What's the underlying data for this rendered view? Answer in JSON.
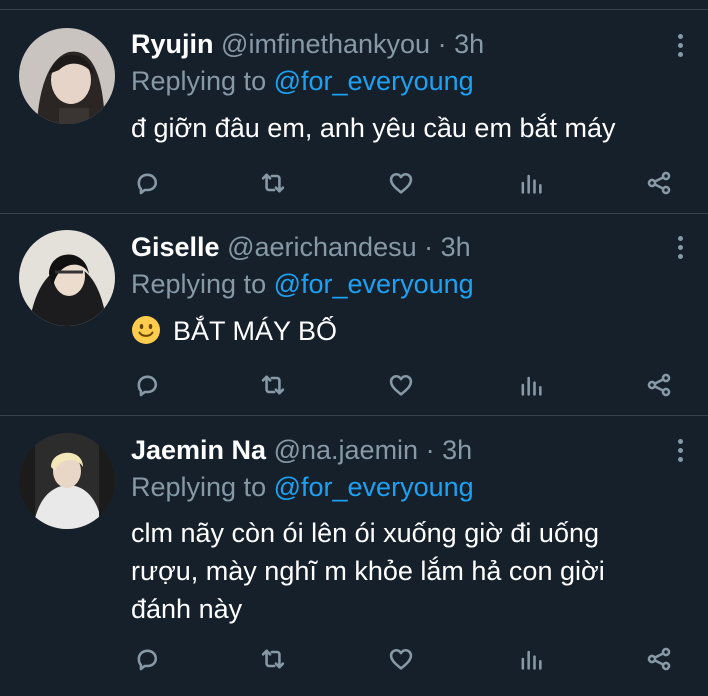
{
  "colors": {
    "background": "#15202b",
    "divider": "#38444d",
    "secondary_text": "#8899a6",
    "mention": "#1da1f2",
    "primary_text": "#ffffff"
  },
  "tweets": [
    {
      "name": "Ryujin",
      "handle": "@imfinethankyou",
      "separator": "·",
      "time": "3h",
      "replying_prefix": "Replying to",
      "replying_to": "@for_everyoung",
      "text": "đ giỡn đâu em, anh yêu cầu em bắt máy",
      "icons": [
        "reply-icon",
        "retweet-icon",
        "like-icon",
        "analytics-icon",
        "share-icon",
        "more-icon"
      ]
    },
    {
      "name": "Giselle",
      "handle": "@aerichandesu",
      "separator": "·",
      "time": "3h",
      "replying_prefix": "Replying to",
      "replying_to": "@for_everyoung",
      "emoji": "slightly-smiling-face",
      "text": "BẮT MÁY BỐ",
      "icons": [
        "reply-icon",
        "retweet-icon",
        "like-icon",
        "analytics-icon",
        "share-icon",
        "more-icon"
      ]
    },
    {
      "name": "Jaemin Na",
      "handle": "@na.jaemin",
      "separator": "·",
      "time": "3h",
      "replying_prefix": "Replying to",
      "replying_to": "@for_everyoung",
      "text_lines": [
        "clm nãy còn ói lên ói xuống giờ đi uống",
        "rượu, mày nghĩ m khỏe lắm hả con giời",
        "đánh này"
      ],
      "icons": [
        "reply-icon",
        "retweet-icon",
        "like-icon",
        "analytics-icon",
        "share-icon",
        "more-icon"
      ]
    }
  ]
}
